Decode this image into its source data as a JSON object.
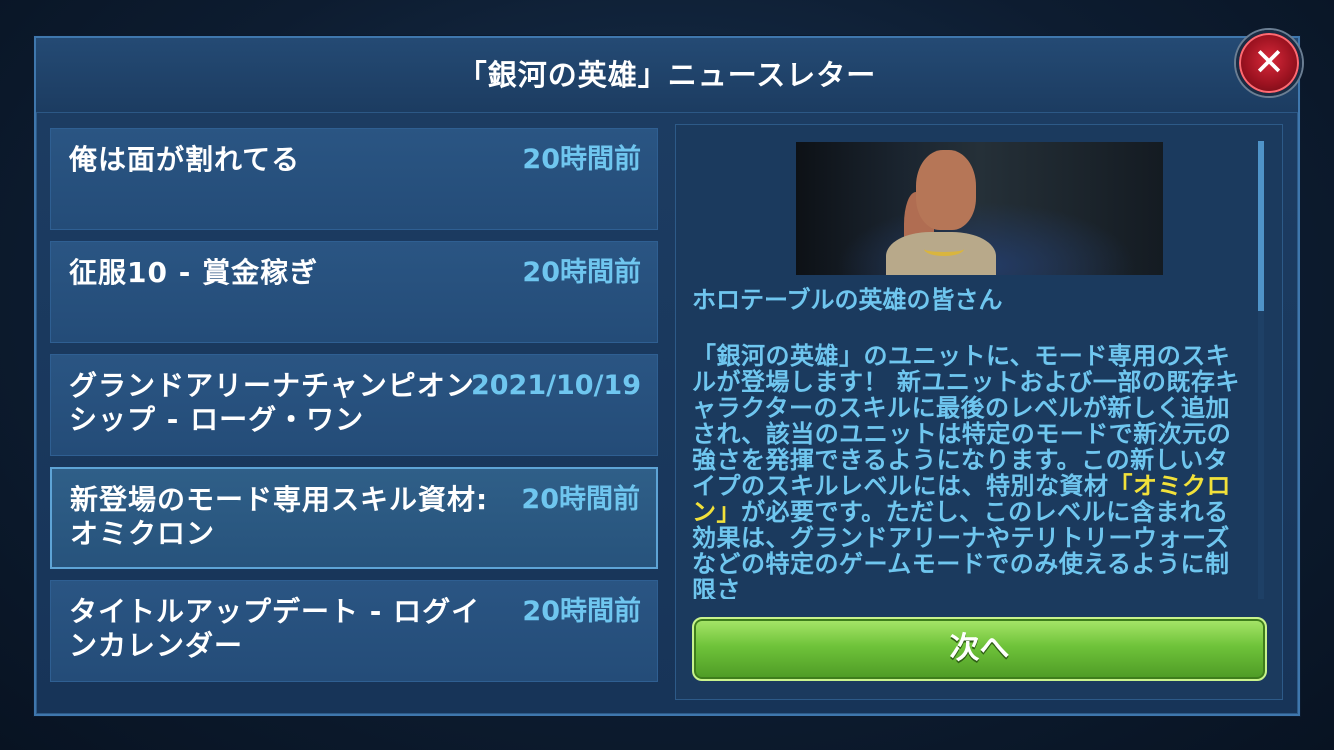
{
  "dialog": {
    "title": "「銀河の英雄」ニュースレター",
    "close_label": "✕"
  },
  "news_list": [
    {
      "title": "俺は面が割れてる",
      "time": "20時間前",
      "selected": false
    },
    {
      "title": "征服10 - 賞金稼ぎ",
      "time": "20時間前",
      "selected": false
    },
    {
      "title": "グランドアリーナチャンピオンシップ - ローグ・ワン",
      "time": "2021/10/19",
      "selected": false
    },
    {
      "title": "新登場のモード専用スキル資材: オミクロン",
      "time": "20時間前",
      "selected": true
    },
    {
      "title": "タイトルアップデート - ログインカレンダー",
      "time": "20時間前",
      "selected": false
    }
  ],
  "article": {
    "banner_icon": "character-portrait-image",
    "heading": "ホロテーブルの英雄の皆さん",
    "body_part1": "「銀河の英雄」のユニットに、モード専用のスキルが登場します！ 新ユニットおよび一部の既存キャラクターのスキルに最後のレベルが新しく追加され、該当のユニットは特定のモードで新次元の強さを発揮できるようになります。この新しいタイプのスキルレベルには、特別な資材",
    "highlight": "「オミクロン」",
    "body_part2": "が必要です。ただし、このレベルに含まれる効果は、グランドアリーナやテリトリーウォーズなどの特定のゲームモードでのみ使えるように制限さ",
    "scroll_position": 0.0
  },
  "next_button": {
    "label": "次へ"
  },
  "colors": {
    "accent_text": "#6fc6ef",
    "highlight_text": "#f2e13a",
    "panel_bg": "#1b3a5e",
    "next_button": "#6fc33a",
    "close_button": "#d8293a"
  }
}
